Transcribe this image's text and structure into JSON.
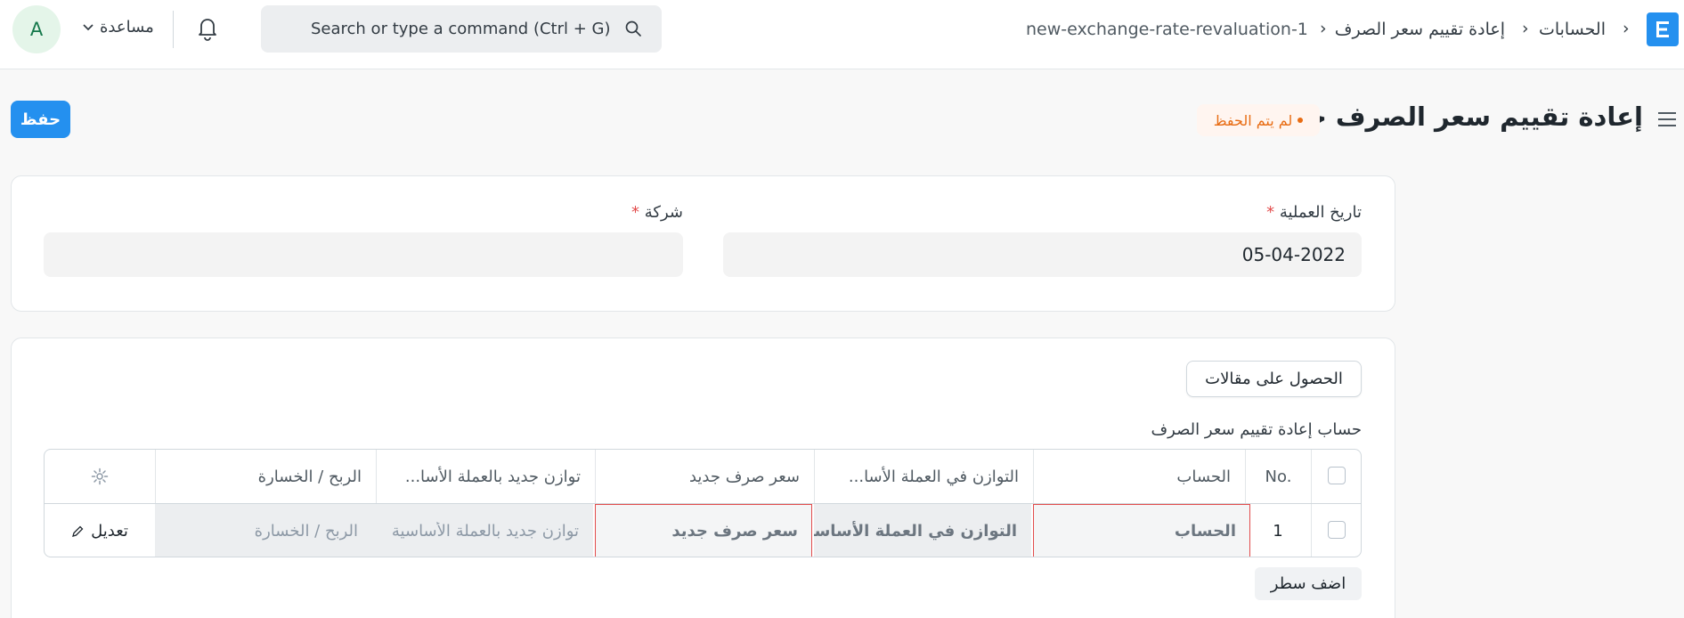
{
  "navbar": {
    "breadcrumbs": [
      "الحسابات",
      "إعادة تقييم سعر الصرف",
      "new-exchange-rate-revaluation-1"
    ],
    "search_placeholder": "Search or type a command (Ctrl + G)",
    "help_label": "مساعدة",
    "avatar_initial": "A"
  },
  "page": {
    "title": "إعادة تقييم سعر الصرف جديد",
    "status_badge": "لم يتم الحفظ",
    "save_label": "حفظ"
  },
  "form": {
    "posting_date_label": "تاريخ العملية",
    "posting_date_value": "05-04-2022",
    "company_label": "شركة",
    "company_value": "",
    "required_mark": "*"
  },
  "accounts_section": {
    "get_entries_label": "الحصول على مقالات",
    "grid_title": "حساب إعادة تقييم سعر الصرف",
    "columns": {
      "no": "No.",
      "account": "الحساب",
      "balance_base": "التوازن في العملة الأسا...",
      "new_rate": "سعر صرف جديد",
      "new_balance_base": "توازن جديد بالعملة الأسا...",
      "gain_loss": "الربح / الخسارة"
    },
    "rows": [
      {
        "idx": "1",
        "account": "الحساب",
        "balance_base": "التوازن في العملة الأساسية",
        "new_rate": "سعر صرف جديد",
        "new_balance_base": "توازن جديد بالعملة الأساسية",
        "gain_loss": "الربح / الخسارة",
        "edit_label": "تعديل"
      }
    ],
    "add_row_label": "اضف سطر"
  },
  "colors": {
    "primary": "#2490ef",
    "error": "#e24c4c",
    "warning": "#e86c13"
  }
}
